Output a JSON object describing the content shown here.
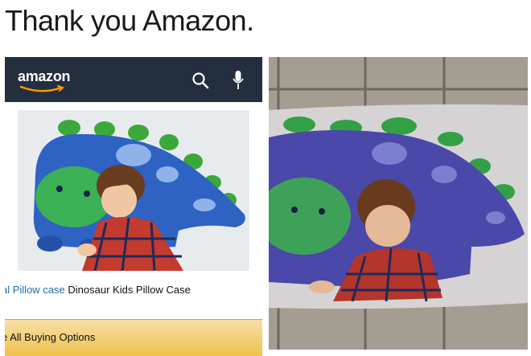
{
  "meme": {
    "title": "Thank you Amazon."
  },
  "amazon": {
    "logo": "amazon",
    "product_brand": "al Pillow case",
    "product_name": "Dinosaur Kids Pillow Case",
    "buying_options": "e All Buying Options"
  },
  "colors": {
    "header_bg": "#232f3e",
    "accent_orange": "#f0c14b",
    "link_blue": "#1d6fa6"
  }
}
